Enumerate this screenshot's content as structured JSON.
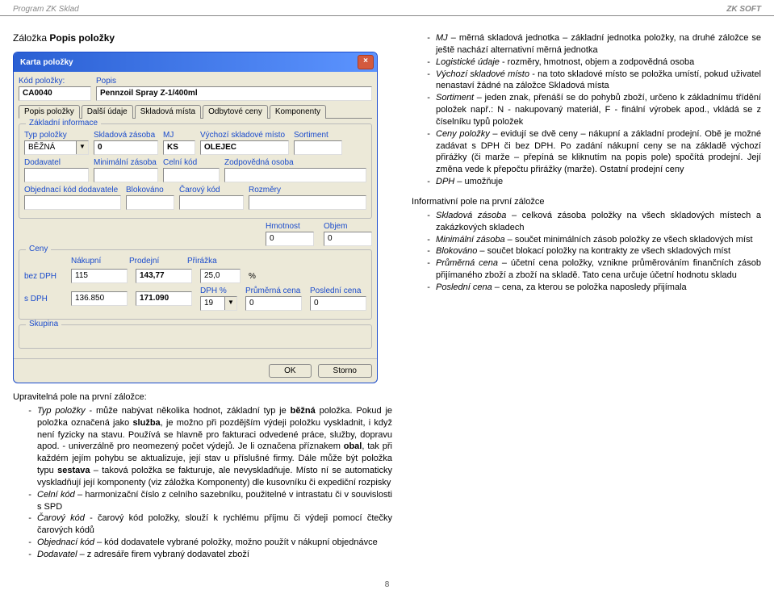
{
  "header": {
    "program": "Program ZK Sklad",
    "brand": "ZK SOFT"
  },
  "title": {
    "prefix": "Záložka",
    "main": "Popis položky"
  },
  "win": {
    "title": "Karta položky",
    "kod_label": "Kód položky:",
    "kod_value": "CA0040",
    "popis_label": "Popis",
    "popis_value": "Pennzoil Spray Z-1/400ml",
    "tabs": [
      "Popis položky",
      "Další údaje",
      "Skladová místa",
      "Odbytové ceny",
      "Komponenty"
    ],
    "group_basic": "Základní informace",
    "fields": {
      "typ": {
        "label": "Typ položky",
        "value": "BĚŽNÁ"
      },
      "zasoba": {
        "label": "Skladová zásoba",
        "value": "0"
      },
      "mj": {
        "label": "MJ",
        "value": "KS"
      },
      "vychozi": {
        "label": "Výchozí skladové místo",
        "value": "OLEJEC"
      },
      "sortiment": {
        "label": "Sortiment",
        "value": ""
      },
      "dodavatel": {
        "label": "Dodavatel",
        "value": ""
      },
      "min": {
        "label": "Minimální zásoba",
        "value": ""
      },
      "celni": {
        "label": "Celní kód",
        "value": ""
      },
      "zodp": {
        "label": "Zodpovědná osoba",
        "value": ""
      },
      "objkod": {
        "label": "Objednací kód dodavatele",
        "value": ""
      },
      "blok": {
        "label": "Blokováno",
        "value": ""
      },
      "carovy": {
        "label": "Čarový kód",
        "value": ""
      },
      "rozmery": {
        "label": "Rozměry",
        "value": ""
      },
      "hmotnost": {
        "label": "Hmotnost",
        "value": "0"
      },
      "objem": {
        "label": "Objem",
        "value": "0"
      }
    },
    "group_ceny": "Ceny",
    "price_headers": {
      "nakupni": "Nákupní",
      "prodejni": "Prodejní",
      "prirazka": "Přirážka"
    },
    "prices": {
      "bezDPH": {
        "label": "bez DPH",
        "nakup": "115",
        "prodej": "143,77",
        "prir": "25,0",
        "pct": "%"
      },
      "sDPH": {
        "label": "s DPH",
        "nakup": "136.850",
        "prodej": "171.090"
      },
      "dph": {
        "label": "DPH %",
        "value": "19"
      },
      "prumerna": {
        "label": "Průměrná cena",
        "value": "0"
      },
      "posledni": {
        "label": "Poslední cena",
        "value": "0"
      }
    },
    "group_skupina": "Skupina",
    "buttons": {
      "ok": "OK",
      "storno": "Storno"
    }
  },
  "left_text": {
    "intro": "Upravitelná pole na první záložce:",
    "bullets": [
      "<span class='em'>Typ položky</span> - může nabývat několika hodnot, základní typ je <span class='bld'>běžná</span> položka. Pokud je položka označená jako <span class='bld'>služba</span>, je možno při pozdějším výdeji položku vyskladnit, i když není fyzicky na stavu. Používá se hlavně pro fakturaci odvedené práce, služby, dopravu apod. - univerzálně pro neomezený počet výdejů. Je li označena příznakem <span class='bld'>obal</span>, tak při každém jejím pohybu se aktualizuje, její stav u příslušné firmy. Dále může být položka typu <span class='bld'>sestava</span> – taková položka se fakturuje, ale nevyskladňuje. Místo ní se automaticky vyskladňují její komponenty (viz záložka Komponenty) dle kusovníku či expediční rozpisky",
      "<span class='em'>Celní kód</span> – harmonizační číslo z celního sazebníku, použitelné v intrastatu či v souvislosti s SPD",
      "<span class='em'>Čarový kód</span> - čarový kód položky, slouží k rychlému příjmu či výdeji pomocí čtečky čarových kódů",
      "<span class='em'>Objednací kód</span> – kód dodavatele vybrané položky, možno použít v nákupní objednávce",
      "<span class='em'>Dodavatel</span> – z adresáře firem vybraný dodavatel zboží"
    ]
  },
  "right_text": {
    "bullets1": [
      "<span class='em'>MJ</span> – měrná skladová jednotka – základní jednotka položky, na druhé záložce se ještě nachází alternativní měrná jednotka",
      "<span class='em'>Logistické údaje</span> - rozměry, hmotnost, objem a zodpovědná osoba",
      "<span class='em'>Výchozí skladové místo</span> - na toto skladové místo se položka umístí, pokud uživatel nenastaví žádné na záložce Skladová místa",
      "<span class='em'>Sortiment</span> – jeden znak, přenáší se do pohybů zboží, určeno k základnímu třídění položek např.: N - nakupovaný materiál, F - finální výrobek apod., vkládá se z číselníku typů položek",
      "<span class='em'>Ceny položky</span> – evidují se dvě ceny – nákupní a základní prodejní. Obě je možné zadávat s DPH či bez DPH. Po zadání nákupní ceny se na základě výchozí přirážky (či marže – přepíná se kliknutím na popis pole) spočítá prodejní. Její změna vede k přepočtu přirážky (marže). Ostatní prodejní ceny",
      "<span class='em'>DPH</span> – umožňuje"
    ],
    "intro2": "Informativní pole na první záložce",
    "bullets2": [
      "<span class='em'>Skladová zásoba</span> – celková zásoba položky na všech skladových místech a zakázkových skladech",
      "<span class='em'>Minimální zásoba</span> – součet minimálních zásob položky ze všech skladových míst",
      "<span class='em'>Blokováno</span> – součet blokací položky na kontrakty ze všech skladových míst",
      "<span class='em'>Průměrná cena</span> – účetní cena položky, vznikne průměrováním finančních zásob přijímaného zboží a zboží na skladě. Tato cena určuje účetní hodnotu skladu",
      "<span class='em'>Poslední cena</span> – cena, za kterou se položka naposledy přijímala"
    ]
  },
  "page_number": "8"
}
